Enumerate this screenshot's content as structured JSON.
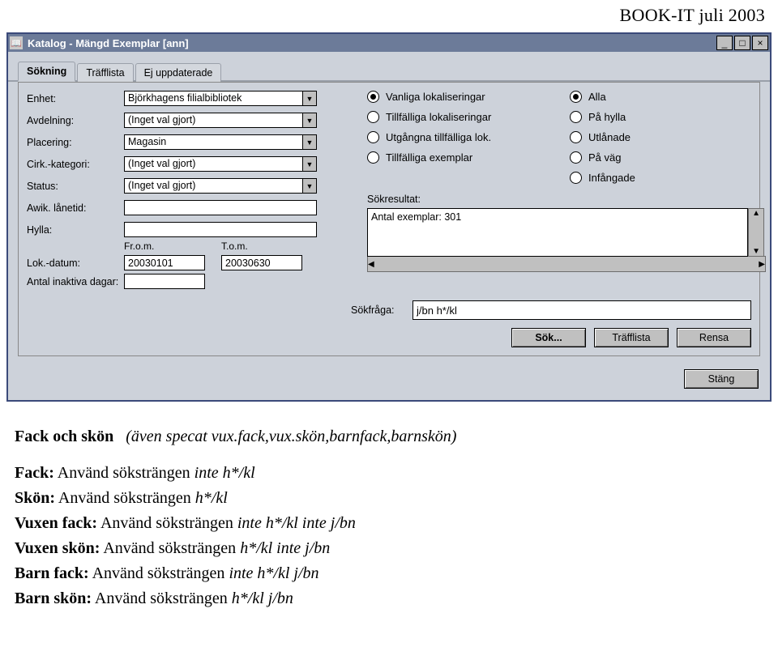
{
  "page_header": "BOOK-IT juli 2003",
  "window": {
    "title": "Katalog - Mängd Exemplar [ann]",
    "icon_glyph": "📖"
  },
  "tabs": [
    "Sökning",
    "Träfflista",
    "Ej uppdaterade"
  ],
  "active_tab": 0,
  "labels": {
    "enhet": "Enhet:",
    "avdelning": "Avdelning:",
    "placering": "Placering:",
    "cirk": "Cirk.-kategori:",
    "status": "Status:",
    "awvik": "Awik. lånetid:",
    "hylla": "Hylla:",
    "from": "Fr.o.m.",
    "tom": "T.o.m.",
    "lokdatum": "Lok.-datum:",
    "antal_inaktiva": "Antal inaktiva dagar:",
    "sokresultat": "Sökresultat:",
    "sokfraga": "Sökfråga:"
  },
  "combos": {
    "enhet": "Björkhagens filialbibliotek",
    "avdelning": "(Inget val gjort)",
    "placering": "Magasin",
    "cirk": "(Inget val gjort)",
    "status": "(Inget val gjort)"
  },
  "radios_col1": [
    "Vanliga lokaliseringar",
    "Tillfälliga lokaliseringar",
    "Utgångna tillfälliga lok.",
    "Tillfälliga exemplar"
  ],
  "radios_col1_selected": 0,
  "radios_col2": [
    "Alla",
    "På hylla",
    "Utlånade",
    "På väg",
    "Infångade"
  ],
  "radios_col2_selected": 0,
  "dates": {
    "from": "20030101",
    "to": "20030630"
  },
  "antal_inaktiva_value": "",
  "result_text": "Antal exemplar: 301",
  "sokfraga_value": "j/bn h*/kl",
  "buttons": {
    "sok": "Sök...",
    "trafflista": "Träfflista",
    "rensa": "Rensa",
    "stang": "Stäng"
  },
  "doc": {
    "title_bold": "Fack och skön",
    "title_italic": "(även specat vux.fack,vux.skön,barnfack,barnskön)",
    "lines": [
      {
        "b": "Fack:",
        "plain": " Använd söksträngen ",
        "i": "inte h*/kl"
      },
      {
        "b": "Skön:",
        "plain": " Använd söksträngen ",
        "i": "h*/kl"
      },
      {
        "b": "Vuxen fack:",
        "plain": " Använd söksträngen ",
        "i": "inte h*/kl  inte j/bn"
      },
      {
        "b": "Vuxen skön:",
        "plain": " Använd söksträngen ",
        "i": "h*/kl  inte j/bn"
      },
      {
        "b": "Barn fack:",
        "plain": "  Använd söksträngen ",
        "i": "inte h*/kl   j/bn"
      },
      {
        "b": "Barn skön:",
        "plain": "  Använd söksträngen ",
        "i": "h*/kl   j/bn"
      }
    ]
  }
}
